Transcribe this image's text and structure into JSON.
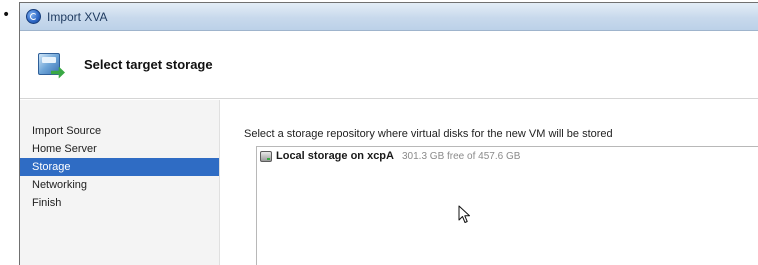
{
  "window": {
    "title": "Import XVA"
  },
  "header": {
    "title": "Select target storage"
  },
  "sidebar": {
    "items": [
      {
        "label": "Import Source"
      },
      {
        "label": "Home Server"
      },
      {
        "label": "Storage"
      },
      {
        "label": "Networking"
      },
      {
        "label": "Finish"
      }
    ],
    "active_index": 2
  },
  "main": {
    "instruction": "Select a storage repository where virtual disks for the new VM will be stored",
    "storage": [
      {
        "name": "Local storage on xcpA",
        "free": "301.3 GB free of 457.6 GB"
      }
    ]
  },
  "bullet": "•",
  "icons": {
    "app": "xen-app-icon",
    "header": "import-storage-icon",
    "disk": "disk-icon",
    "cursor": "mouse-pointer-icon"
  },
  "colors": {
    "selection": "#2f6cc4",
    "titlebar": "#c8d9ec"
  }
}
